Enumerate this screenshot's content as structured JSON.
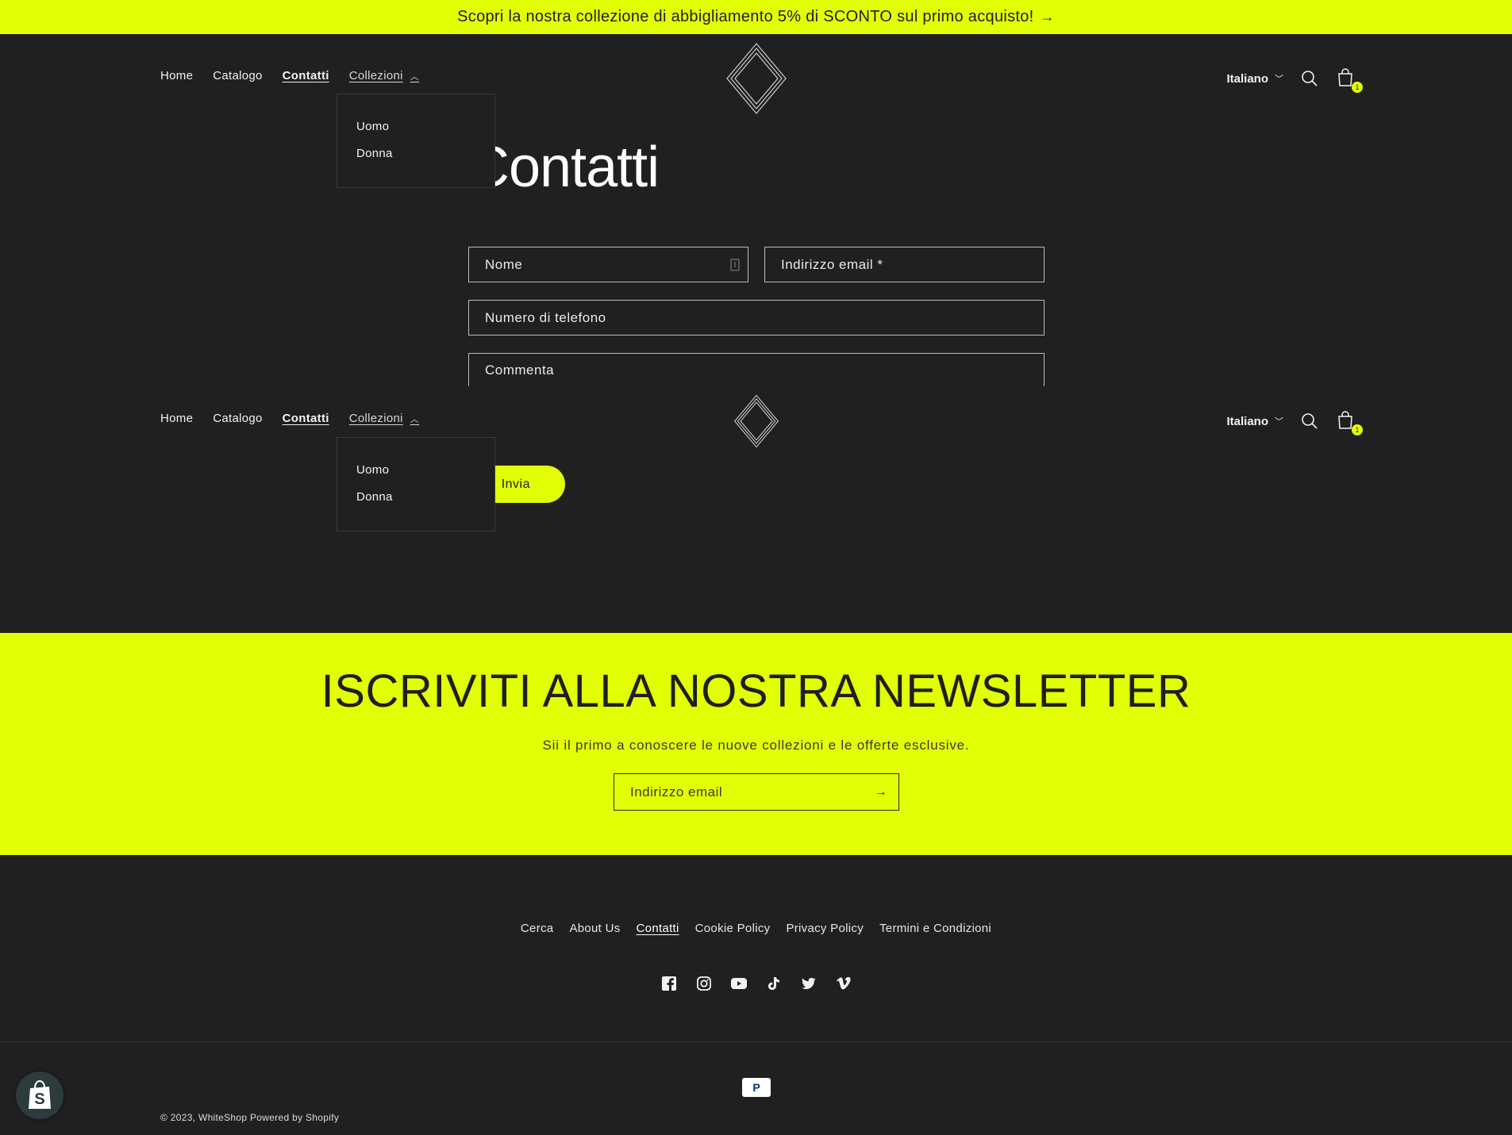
{
  "announcement": {
    "text": "Scopri la nostra collezione di abbigliamento 5% di SCONTO sul primo acquisto!",
    "arrow": "→"
  },
  "nav": {
    "items": [
      "Home",
      "Catalogo",
      "Contatti",
      "Collezioni"
    ],
    "active": "Contatti"
  },
  "collections_menu": [
    "Uomo",
    "Donna"
  ],
  "header_right": {
    "language": "Italiano",
    "cart_count": "1"
  },
  "page": {
    "title": "Contatti"
  },
  "form": {
    "name_placeholder": "Nome",
    "email_placeholder": "Indirizzo email *",
    "phone_placeholder": "Numero di telefono",
    "comment_placeholder": "Commenta",
    "submit_label": "Invia"
  },
  "newsletter": {
    "title": "ISCRIVITI ALLA NOSTRA NEWSLETTER",
    "subtitle": "Sii il primo a conoscere le nuove collezioni e le offerte esclusive.",
    "email_placeholder": "Indirizzo email",
    "arrow": "→"
  },
  "footer": {
    "links": [
      "Cerca",
      "About Us",
      "Contatti",
      "Cookie Policy",
      "Privacy Policy",
      "Termini e Condizioni"
    ],
    "social": [
      "facebook-icon",
      "instagram-icon",
      "youtube-icon",
      "tiktok-icon",
      "twitter-icon",
      "vimeo-icon"
    ],
    "payment": "P",
    "copyright_prefix": "© 2023,",
    "shop_name": "WhiteShop",
    "powered_by": "Powered by Shopify"
  },
  "colors": {
    "accent": "#e3ff05",
    "background": "#202020",
    "text": "#f2f2f2"
  }
}
